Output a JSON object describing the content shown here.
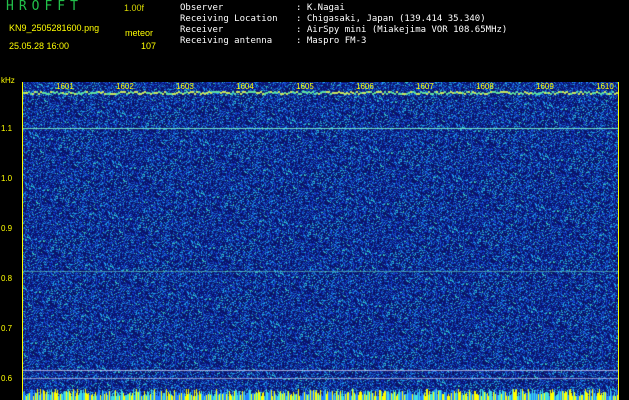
{
  "header": {
    "app_title": "HROFFT",
    "version": "1.00f",
    "filename": "KN9_2505281600.png",
    "datetime": "25.05.28 16:00",
    "meteor_label": "meteor",
    "meteor_count": "107"
  },
  "info": [
    {
      "key": "Observer",
      "value": ": K.Nagai"
    },
    {
      "key": "Receiving Location",
      "value": ": Chigasaki, Japan (139.414 35.340)"
    },
    {
      "key": "Receiver",
      "value": ": AirSpy mini (Miakejima VOR 108.65MHz)"
    },
    {
      "key": "Receiving antenna",
      "value": ": Maspro FM-3"
    }
  ],
  "axis": {
    "unit": "kHz",
    "y_ticks": [
      "1.1",
      "1.0",
      "0.9",
      "0.8",
      "0.7",
      "0.6"
    ],
    "x_ticks": [
      "1601",
      "1602",
      "1603",
      "1604",
      "1605",
      "1606",
      "1607",
      "1608",
      "1609",
      "1610"
    ]
  },
  "colors": {
    "background": "#000000",
    "label_yellow": "#ffff00",
    "title_green": "#22c04a",
    "noise_blue": "#1a2a9a"
  }
}
